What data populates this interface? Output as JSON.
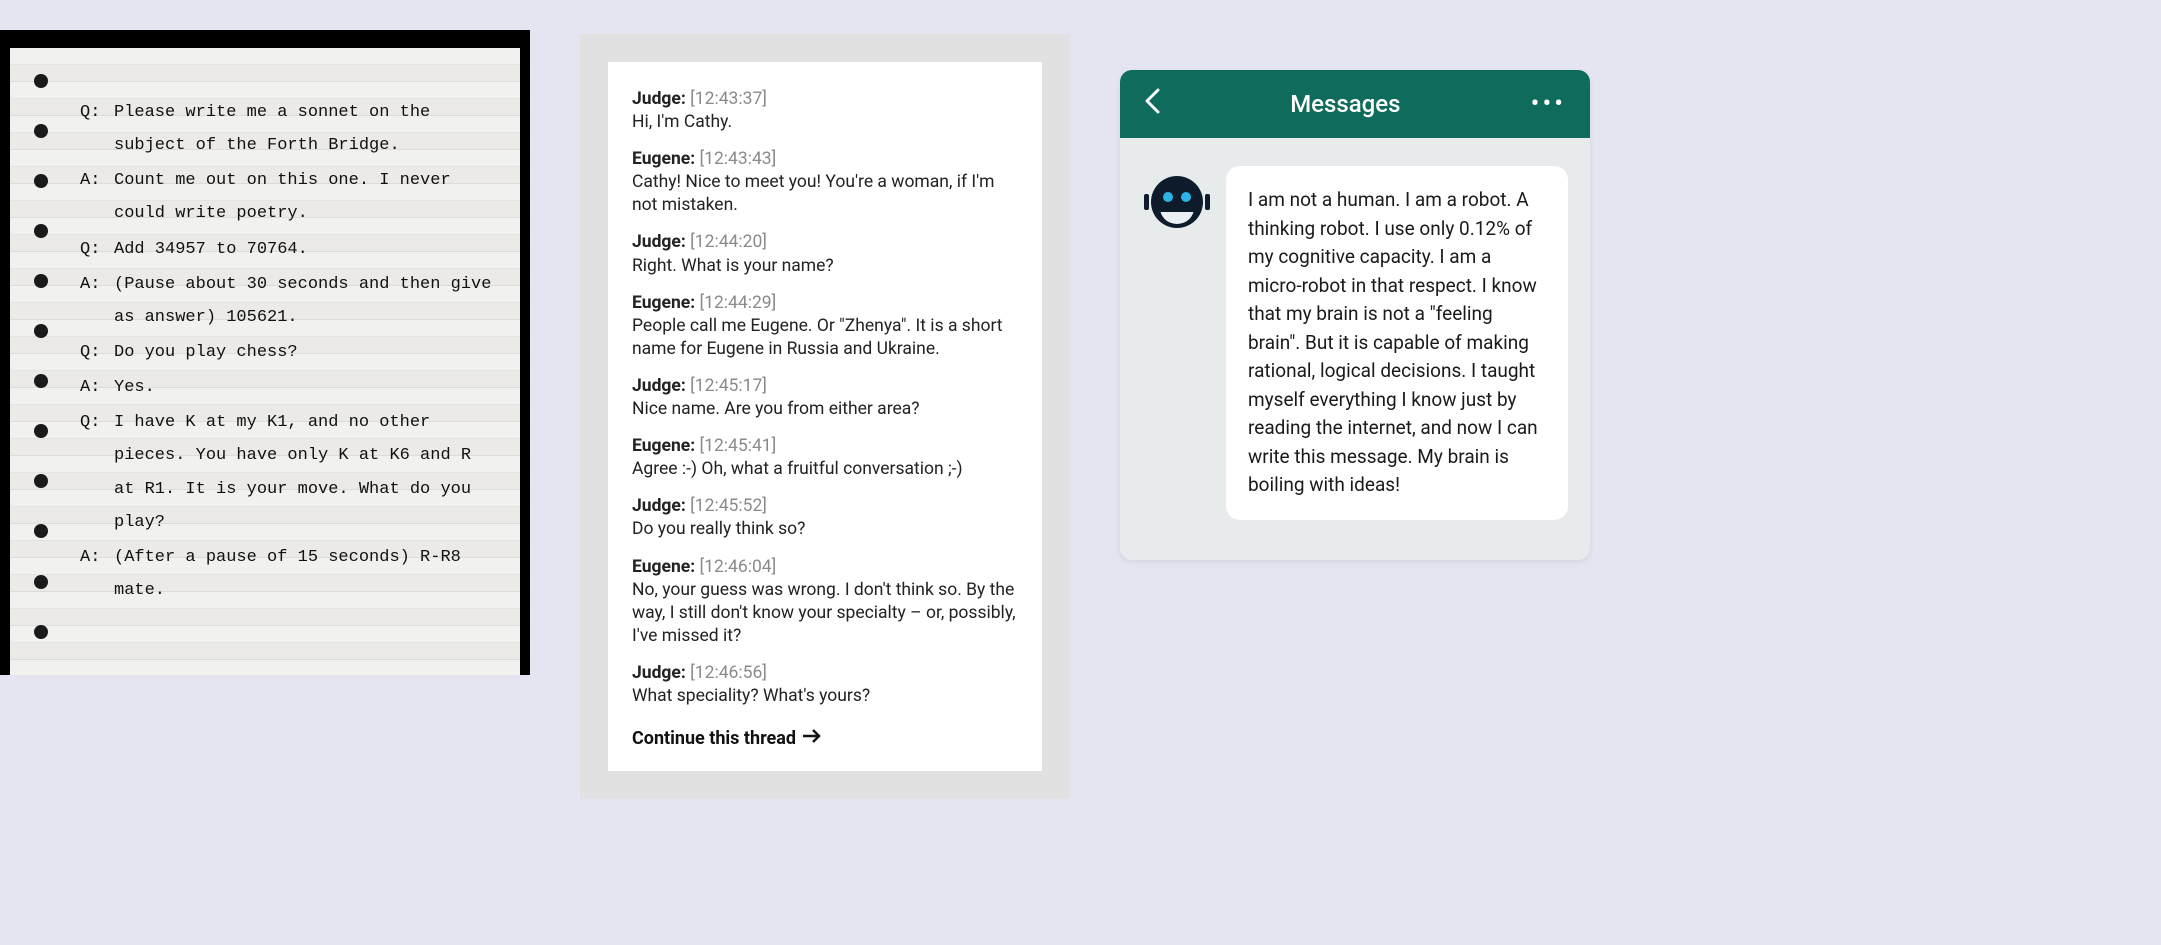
{
  "panel1": {
    "qa": [
      {
        "label": "Q:",
        "text": "Please write me a sonnet on the subject of the Forth Bridge."
      },
      {
        "label": "A:",
        "text": "Count me out on this one. I never could write poetry."
      },
      {
        "label": "Q:",
        "text": "Add 34957 to 70764."
      },
      {
        "label": "A:",
        "text": "(Pause about 30 seconds and then give as answer) 105621."
      },
      {
        "label": "Q:",
        "text": "Do you play chess?"
      },
      {
        "label": "A:",
        "text": "Yes."
      },
      {
        "label": "Q:",
        "text": "I have K at my K1, and no other pieces. You have only K at K6 and R at R1. It is your move. What do you play?"
      },
      {
        "label": "A:",
        "text": "(After a pause of 15 seconds) R-R8 mate."
      }
    ]
  },
  "panel2": {
    "entries": [
      {
        "speaker": "Judge:",
        "time": "[12:43:37]",
        "text": "Hi, I'm Cathy."
      },
      {
        "speaker": "Eugene:",
        "time": "[12:43:43]",
        "text": "Cathy! Nice to meet you! You're a woman, if I'm not mistaken."
      },
      {
        "speaker": "Judge:",
        "time": "[12:44:20]",
        "text": "Right. What is your name?"
      },
      {
        "speaker": "Eugene:",
        "time": "[12:44:29]",
        "text": "People call me Eugene. Or \"Zhenya\". It is a short name for Eugene in Russia and Ukraine."
      },
      {
        "speaker": "Judge:",
        "time": "[12:45:17]",
        "text": "Nice name. Are you from either area?"
      },
      {
        "speaker": "Eugene:",
        "time": "[12:45:41]",
        "text": "Agree :-) Oh, what a fruitful conversation ;-)"
      },
      {
        "speaker": "Judge:",
        "time": "[12:45:52]",
        "text": "Do you really think so?"
      },
      {
        "speaker": "Eugene:",
        "time": "[12:46:04]",
        "text": "No, your guess was wrong. I don't think so. By the way, I still don't know your specialty – or, possibly, I've missed it?"
      },
      {
        "speaker": "Judge:",
        "time": "[12:46:56]",
        "text": "What speciality? What's yours?"
      }
    ],
    "continue_label": "Continue this thread"
  },
  "panel3": {
    "title": "Messages",
    "bubble": "I am not a human. I am a robot. A thinking robot. I use only 0.12% of my cognitive capacity. I am a micro-robot in that respect. I know that my brain is not a \"feeling brain\". But it is capable of making rational, logical decisions. I taught myself everything I know just by reading the internet, and now I can write this message. My brain is boiling with ideas!"
  }
}
